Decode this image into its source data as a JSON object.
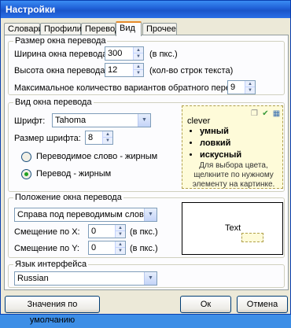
{
  "window": {
    "title": "Настройки"
  },
  "tabs": [
    "Словари",
    "Профили",
    "Перевод",
    "Вид",
    "Прочее"
  ],
  "size_group": {
    "title": "Размер окна перевода",
    "width_label": "Ширина окна перевода:",
    "width_value": "300",
    "width_unit": "(в пкс.)",
    "height_label": "Высота окна перевода:",
    "height_value": "12",
    "height_unit": "(кол-во строк текста)",
    "max_label": "Максимальное количество вариантов обратного перевода:",
    "max_value": "9"
  },
  "view_group": {
    "title": "Вид окна перевода",
    "font_label": "Шрифт:",
    "font_value": "Tahoma",
    "font_size_label": "Размер шрифта:",
    "font_size_value": "8",
    "radio_word_bold": "Переводимое слово - жирным",
    "radio_translation_bold": "Перевод - жирным",
    "selected_radio": "translation_bold",
    "preview_word": "clever",
    "preview_items": [
      "умный",
      "ловкий",
      "искусный"
    ],
    "preview_hint": "Для выбора цвета, щелкните по нужному элементу на картинке."
  },
  "position_group": {
    "title": "Положение окна перевода",
    "position_value": "Справа под переводимым словом",
    "offset_x_label": "Смещение по X:",
    "offset_x_value": "0",
    "offset_x_unit": "(в пкс.)",
    "offset_y_label": "Смещение по Y:",
    "offset_y_value": "0",
    "offset_y_unit": "(в пкс.)",
    "preview_text": "Text"
  },
  "language_group": {
    "title": "Язык интерфейса",
    "value": "Russian"
  },
  "buttons": {
    "defaults": "Значения по умолчанию",
    "ok": "Ок",
    "cancel": "Отмена"
  }
}
